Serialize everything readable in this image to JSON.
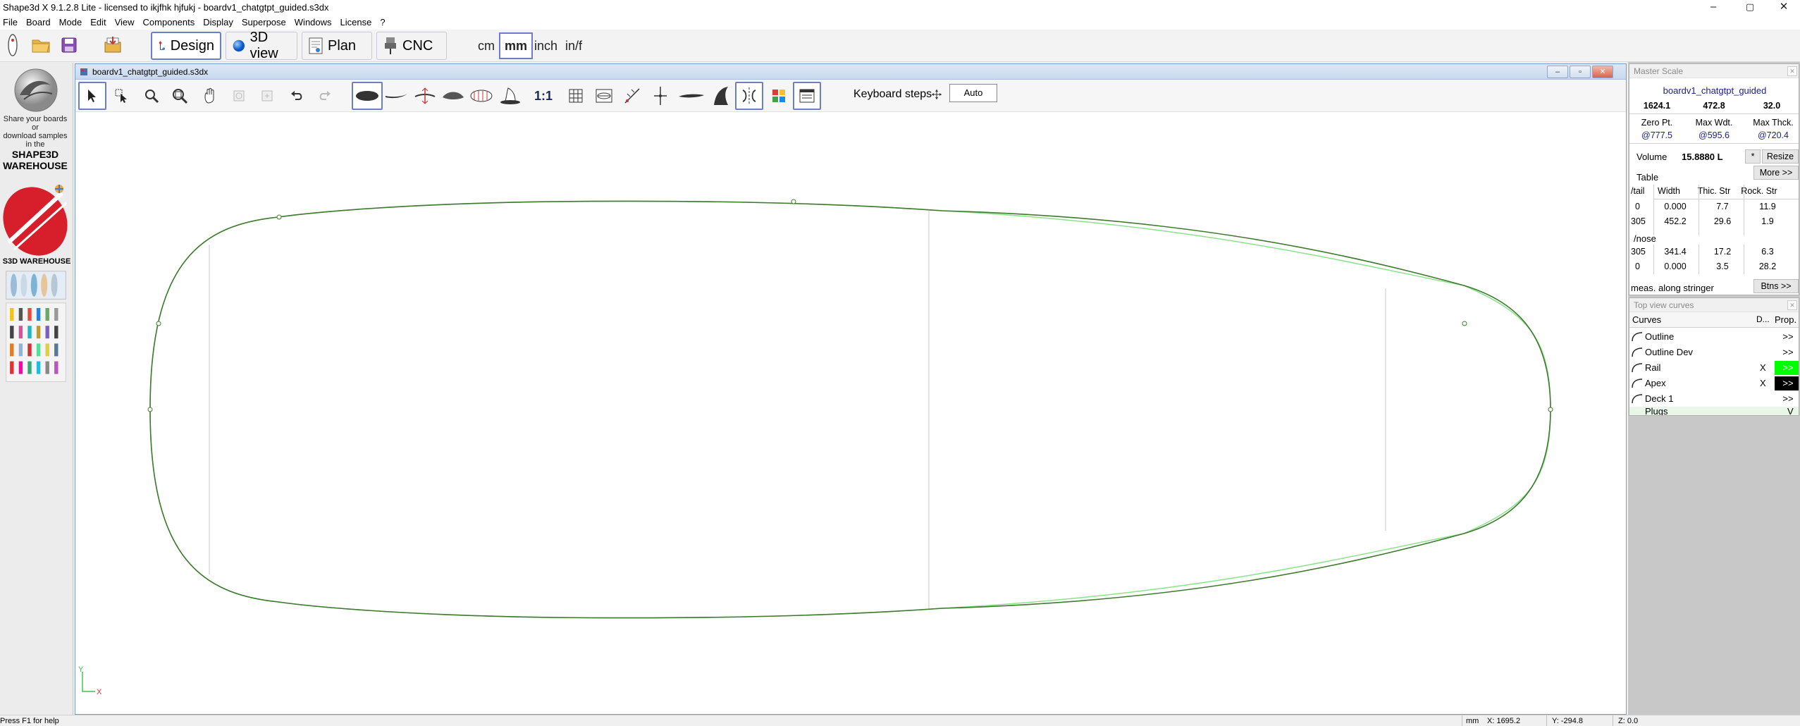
{
  "window": {
    "title": "Shape3d X 9.1.2.8 Lite - licensed to ikjfhk hjfukj - boardv1_chatgtpt_guided.s3dx",
    "min": "–",
    "max": "▢",
    "close": "✕"
  },
  "menu": [
    "File",
    "Board",
    "Mode",
    "Edit",
    "View",
    "Components",
    "Display",
    "Superpose",
    "Windows",
    "License",
    "?"
  ],
  "modes": {
    "design": "Design",
    "view3d": "3D view",
    "plan": "Plan",
    "cnc": "CNC",
    "active": "Design"
  },
  "units": {
    "cm": "cm",
    "mm": "mm",
    "inch": "inch",
    "inf": "in/f",
    "active": "mm"
  },
  "sidebar": {
    "share_text_1": "Share your boards",
    "share_text_2": "or",
    "share_text_3": "download samples",
    "share_text_4": "in the",
    "warehouse_1": "SHAPE3D",
    "warehouse_2": "WAREHOUSE",
    "warehouse_tag": "S3D WAREHOUSE"
  },
  "document": {
    "filename": "boardv1_chatgtpt_guided.s3dx",
    "keyboard_steps_label": "Keyboard steps",
    "keyboard_steps_value": "Auto",
    "scale_1to1": "1:1",
    "axis_x": "X",
    "axis_y": "Y"
  },
  "master_scale": {
    "header": "Master Scale",
    "board_name": "boardv1_chatgtpt_guided",
    "length": "1624.1",
    "width": "472.8",
    "thickness": "32.0",
    "zero_pt_label": "Zero Pt.",
    "max_wdt_label": "Max Wdt.",
    "max_thck_label": "Max Thck.",
    "zero_pt_value": "@777.5",
    "max_wdt_value": "@595.6",
    "max_thck_value": "@720.4",
    "volume_label": "Volume",
    "volume_value": "15.8880 L",
    "star_btn": "*",
    "resize_btn": "Resize",
    "more_btn": "More >>",
    "table_label": "Table",
    "tail_label": "/tail",
    "col_width": "Width",
    "col_thic": "Thic. Str",
    "col_rock": "Rock. Str",
    "tail_rows": [
      {
        "pos": "0",
        "width": "0.000",
        "thic": "7.7",
        "rock": "11.9"
      },
      {
        "pos": "305",
        "width": "452.2",
        "thic": "29.6",
        "rock": "1.9"
      }
    ],
    "nose_label": "/nose",
    "nose_rows": [
      {
        "pos": "305",
        "width": "341.4",
        "thic": "17.2",
        "rock": "6.3"
      },
      {
        "pos": "0",
        "width": "0.000",
        "thic": "3.5",
        "rock": "28.2"
      }
    ],
    "meas_label": "meas. along stringer",
    "btns_btn": "Btns >>"
  },
  "curves_panel": {
    "header": "Top view curves",
    "col_curves": "Curves",
    "col_d": "D...",
    "col_prop": "Prop.",
    "rows": [
      {
        "name": "Outline",
        "x": "",
        "prop": ">>",
        "color": ""
      },
      {
        "name": "Outline Dev",
        "x": "",
        "prop": ">>",
        "color": ""
      },
      {
        "name": "Rail",
        "x": "X",
        "prop": ">>",
        "color": "#00ff00"
      },
      {
        "name": "Apex",
        "x": "X",
        "prop": ">>",
        "color": "#000000"
      },
      {
        "name": "Deck 1",
        "x": "",
        "prop": ">>",
        "color": ""
      }
    ],
    "plugs_label": "Plugs",
    "plugs_value": "V"
  },
  "status": {
    "help": "Press F1 for help",
    "unit": "mm",
    "x": "X: 1695.2",
    "y": "Y: -294.8",
    "z": "Z: 0.0"
  },
  "colors": {
    "outline": "#3f7a2f",
    "outline_dev": "#7fe07f",
    "accent": "#6c7fc4"
  }
}
